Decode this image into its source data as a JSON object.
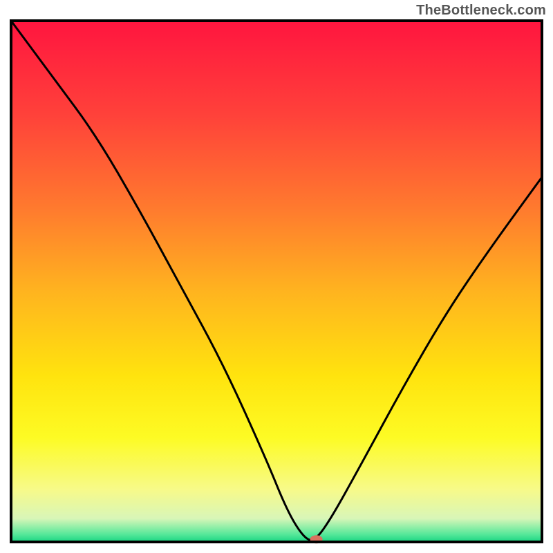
{
  "attribution": "TheBottleneck.com",
  "chart_data": {
    "type": "line",
    "title": "",
    "xlabel": "",
    "ylabel": "",
    "xlim": [
      0,
      100
    ],
    "ylim": [
      0,
      100
    ],
    "grid": false,
    "legend": false,
    "series": [
      {
        "name": "bottleneck-curve",
        "color": "#000000",
        "x": [
          0,
          8,
          16,
          24,
          32,
          40,
          48,
          52,
          55,
          57,
          60,
          66,
          74,
          82,
          90,
          100
        ],
        "values": [
          100,
          89,
          78,
          64,
          49,
          34,
          16,
          6,
          1,
          0,
          4,
          15,
          30,
          44,
          56,
          70
        ]
      }
    ],
    "marker": {
      "name": "optimal-point",
      "x": 57.5,
      "y": 0.5,
      "color": "#d9725f",
      "rx": 9,
      "ry": 6
    },
    "background_gradient": {
      "stops": [
        {
          "offset": 0.0,
          "color": "#ff153f"
        },
        {
          "offset": 0.18,
          "color": "#ff413a"
        },
        {
          "offset": 0.36,
          "color": "#ff7a2e"
        },
        {
          "offset": 0.52,
          "color": "#ffb41f"
        },
        {
          "offset": 0.68,
          "color": "#ffe30e"
        },
        {
          "offset": 0.8,
          "color": "#fdfb24"
        },
        {
          "offset": 0.9,
          "color": "#f7fa8a"
        },
        {
          "offset": 0.955,
          "color": "#d8f6b8"
        },
        {
          "offset": 0.985,
          "color": "#58e89a"
        },
        {
          "offset": 1.0,
          "color": "#19d582"
        }
      ]
    },
    "frame_color": "#000000",
    "frame_width": 4
  }
}
